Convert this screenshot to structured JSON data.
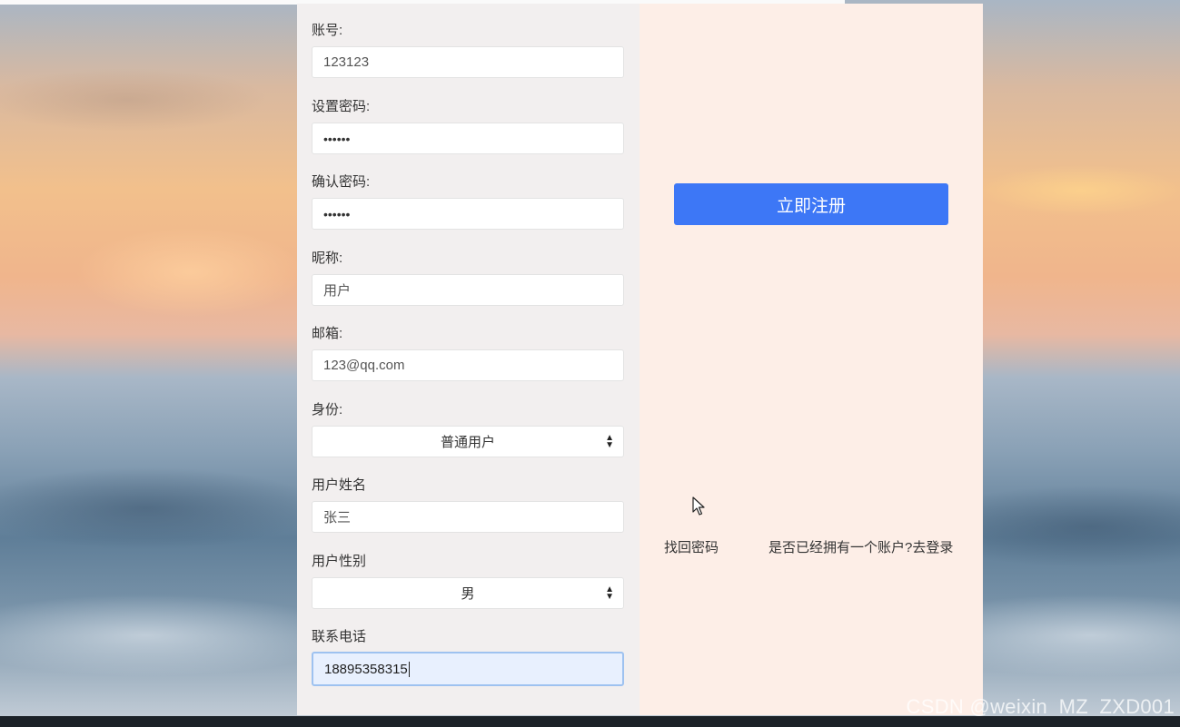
{
  "form": {
    "account": {
      "label": "账号:",
      "value": "123123"
    },
    "password": {
      "label": "设置密码:",
      "value": "••••••"
    },
    "confirm_password": {
      "label": "确认密码:",
      "value": "••••••"
    },
    "nickname": {
      "label": "昵称:",
      "value": "用户"
    },
    "email": {
      "label": "邮箱:",
      "value": "123@qq.com"
    },
    "identity": {
      "label": "身份:",
      "selected": "普通用户"
    },
    "real_name": {
      "label": "用户姓名",
      "value": "张三"
    },
    "gender": {
      "label": "用户性别",
      "selected": "男"
    },
    "phone": {
      "label": "联系电话",
      "value": "18895358315"
    }
  },
  "actions": {
    "register_label": "立即注册",
    "forgot_password": "找回密码",
    "go_login": "是否已经拥有一个账户?去登录"
  },
  "watermark": "CSDN @weixin_MZ_ZXD001",
  "colors": {
    "primary_button": "#3d77f6",
    "left_panel": "#f2efef",
    "right_panel": "#fdeee7"
  }
}
